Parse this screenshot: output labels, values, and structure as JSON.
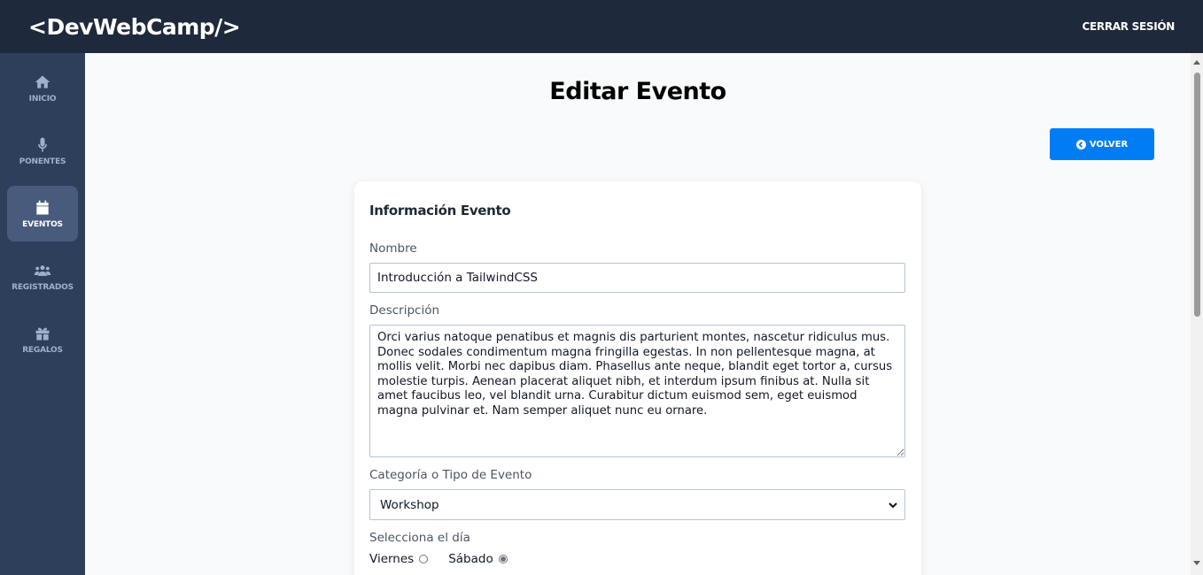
{
  "header": {
    "logo": "<DevWebCamp/>",
    "logout_label": "CERRAR SESIÓN"
  },
  "sidebar": {
    "items": [
      {
        "label": "INICIO",
        "icon": "home-icon",
        "active": false
      },
      {
        "label": "PONENTES",
        "icon": "microphone-icon",
        "active": false
      },
      {
        "label": "EVENTOS",
        "icon": "calendar-icon",
        "active": true
      },
      {
        "label": "REGISTRADOS",
        "icon": "users-icon",
        "active": false
      },
      {
        "label": "REGALOS",
        "icon": "gift-icon",
        "active": false
      }
    ]
  },
  "main": {
    "title": "Editar Evento",
    "back_button_label": "VOLVER"
  },
  "form": {
    "section_title": "Información Evento",
    "nombre_label": "Nombre",
    "nombre_value": "Introducción a TailwindCSS",
    "descripcion_label": "Descripción",
    "descripcion_value": "Orci varius natoque penatibus et magnis dis parturient montes, nascetur ridiculus mus. Donec sodales condimentum magna fringilla egestas. In non pellentesque magna, at mollis velit. Morbi nec dapibus diam. Phasellus ante neque, blandit eget tortor a, cursus molestie turpis. Aenean placerat aliquet nibh, et interdum ipsum finibus at. Nulla sit amet faucibus leo, vel blandit urna. Curabitur dictum euismod sem, eget euismod magna pulvinar et. Nam semper aliquet nunc eu ornare.",
    "categoria_label": "Categoría o Tipo de Evento",
    "categoria_value": "Workshop",
    "dia_label": "Selecciona el día",
    "dias": [
      {
        "label": "Viernes",
        "checked": false
      },
      {
        "label": "Sábado",
        "checked": true
      }
    ]
  },
  "colors": {
    "topbar": "#1e293b",
    "sidebar": "#2e3f5c",
    "sidebar_active": "#485b7d",
    "primary_button": "#007df4"
  }
}
